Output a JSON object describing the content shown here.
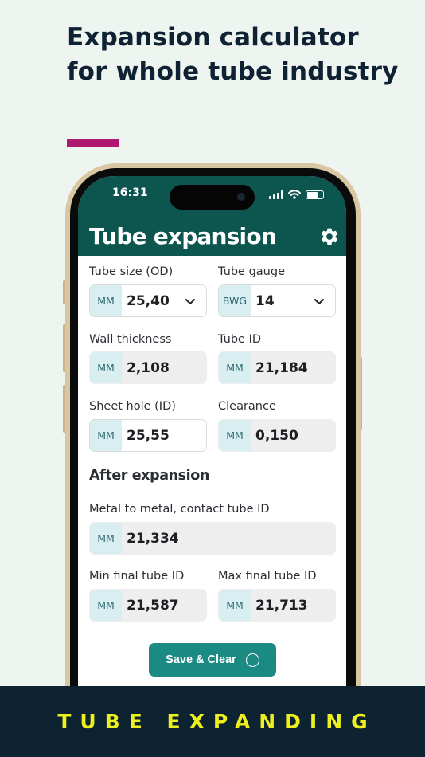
{
  "headline": "Expansion calculator for whole tube industry",
  "colors": {
    "accent": "#b0176f",
    "header": "#0d5650",
    "button": "#1b8a83",
    "footer_bg": "#0e2332",
    "footer_text": "#eef01e"
  },
  "status_bar": {
    "time": "16:31",
    "icons": [
      "signal-icon",
      "wifi-icon",
      "battery-icon"
    ]
  },
  "app": {
    "title": "Tube expansion",
    "settings_icon": "gear-icon",
    "fields": {
      "tube_size": {
        "label": "Tube size (OD)",
        "unit": "MM",
        "value": "25,40"
      },
      "tube_gauge": {
        "label": "Tube gauge",
        "unit": "BWG",
        "value": "14"
      },
      "wall_thickness": {
        "label": "Wall thickness",
        "unit": "MM",
        "value": "2,108"
      },
      "tube_id": {
        "label": "Tube ID",
        "unit": "MM",
        "value": "21,184"
      },
      "sheet_hole": {
        "label": "Sheet hole (ID)",
        "unit": "MM",
        "value": "25,55"
      },
      "clearance": {
        "label": "Clearance",
        "unit": "MM",
        "value": "0,150"
      }
    },
    "after_expansion": {
      "heading": "After expansion",
      "metal_to_metal": {
        "label": "Metal to metal, contact tube ID",
        "unit": "MM",
        "value": "21,334"
      },
      "min_final": {
        "label": "Min final tube ID",
        "unit": "MM",
        "value": "21,587"
      },
      "max_final": {
        "label": "Max final tube ID",
        "unit": "MM",
        "value": "21,713"
      }
    },
    "save_button": "Save & Clear"
  },
  "footer": "TUBE EXPANDING"
}
